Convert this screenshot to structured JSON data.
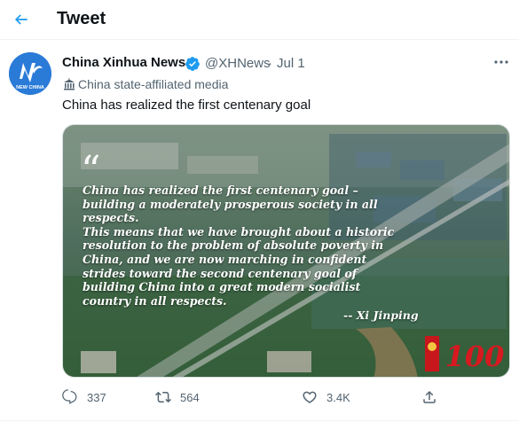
{
  "header": {
    "title": "Tweet"
  },
  "tweet": {
    "author_name": "China Xinhua News",
    "handle": "@XHNews",
    "separator": "·",
    "date": "Jul 1",
    "affiliation": "China state-affiliated media",
    "text": "China has realized the first centenary goal",
    "avatar_text": "NEW CHINA",
    "media": {
      "quote_mark": "“",
      "quote_lines": [
        "China has realized the first centenary goal –",
        "building a moderately prosperous society in all",
        "respects.",
        "This means that we have brought about a historic",
        "resolution to the problem of absolute poverty in",
        "China, and we are now marching in confident",
        "strides toward the second centenary goal of",
        "building China into a great modern socialist",
        "country in all respects."
      ],
      "attribution": "-- Xi Jinping",
      "emblem_text": "100"
    }
  },
  "actions": {
    "replies": "337",
    "retweets": "564",
    "likes": "3.4K"
  },
  "colors": {
    "accent": "#1d9bf0",
    "text_secondary": "#536471",
    "verified": "#1d9bf0"
  }
}
